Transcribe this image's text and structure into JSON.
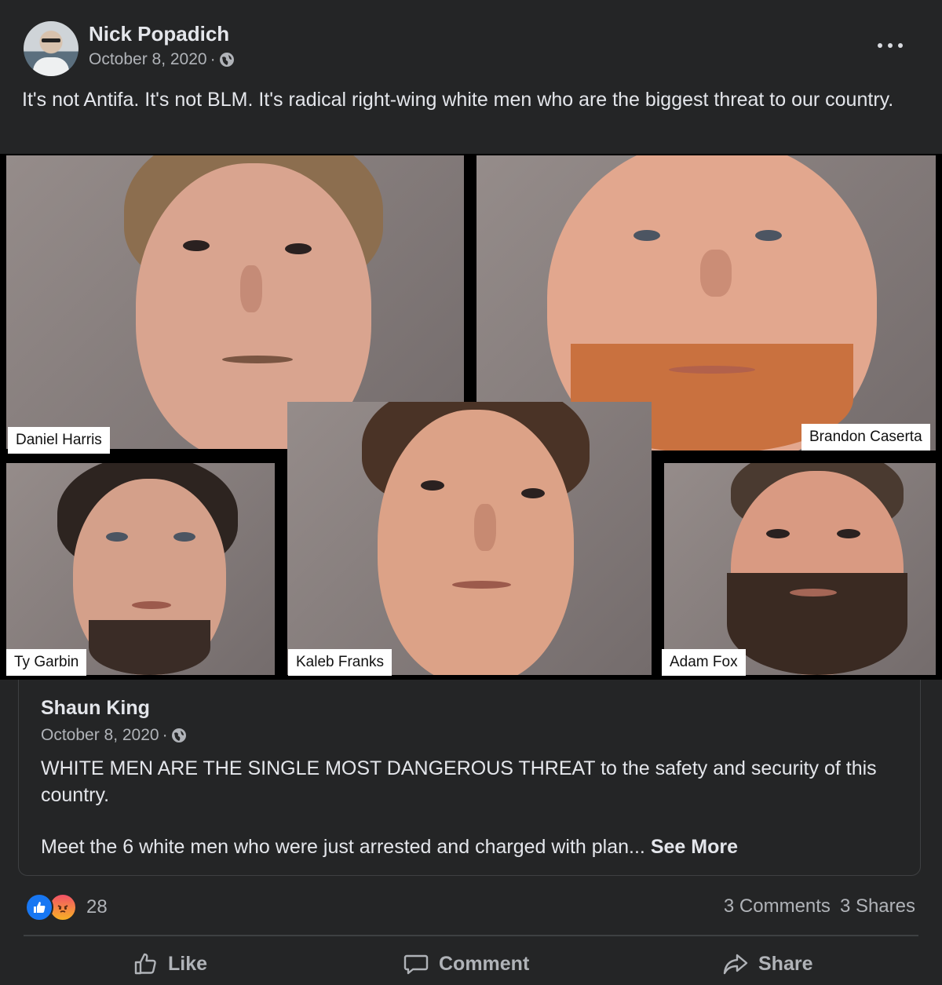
{
  "post": {
    "author": "Nick Popadich",
    "date": "October 8, 2020",
    "separator": "·",
    "text": "It's not Antifa. It's not BLM. It's radical right-wing white men who are the biggest threat to our country."
  },
  "collage": {
    "captions": [
      "Daniel Harris",
      "Brandon Caserta",
      "Ty Garbin",
      "Kaleb Franks",
      "Adam Fox"
    ]
  },
  "shared": {
    "author": "Shaun King",
    "date": "October 8, 2020",
    "separator": "·",
    "text1": "WHITE MEN ARE THE SINGLE MOST DANGEROUS THREAT to the safety and security of this country.",
    "text2": "Meet the 6 white men who were just arrested and charged with plan...",
    "see_more": "See More"
  },
  "footer": {
    "reaction_count": "28",
    "comments": "3 Comments",
    "shares": "3 Shares",
    "like_label": "Like",
    "comment_label": "Comment",
    "share_label": "Share"
  },
  "colors": {
    "background": "#242526",
    "text": "#e4e6eb",
    "muted": "#b0b3b8",
    "like_blue": "#1877f2"
  },
  "icons": [
    "globe-icon",
    "more-icon",
    "like-reaction-icon",
    "angry-reaction-icon",
    "thumbs-up-icon",
    "comment-icon",
    "share-arrow-icon"
  ]
}
